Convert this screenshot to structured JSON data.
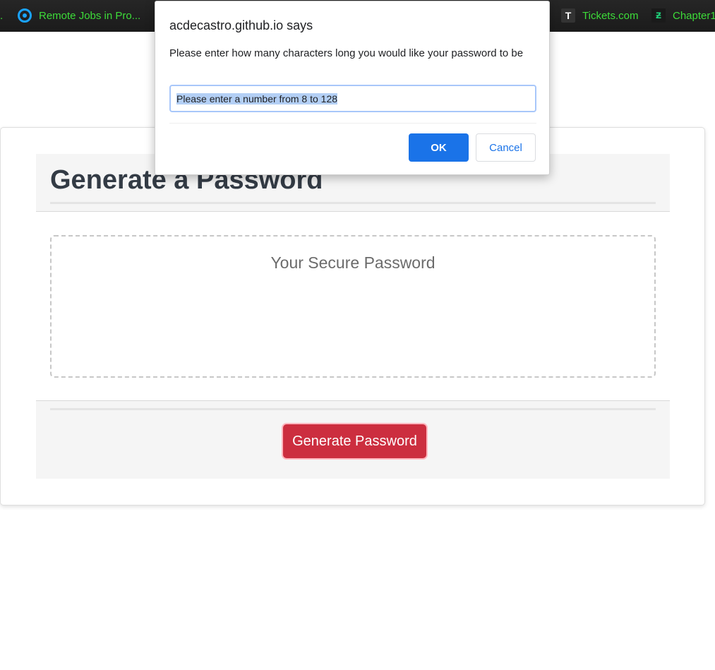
{
  "bookmarks": {
    "items": [
      {
        "label": ".",
        "icon": ""
      },
      {
        "label": "Remote Jobs in Pro...",
        "icon": "remote-jobs-icon"
      },
      {
        "label": "Tickets.com",
        "icon": "tickets-icon",
        "icon_glyph": "T"
      },
      {
        "label": "Chapter1",
        "icon": "chapter-icon",
        "icon_glyph": "ƶ"
      }
    ],
    "text_color": "#3ddc39"
  },
  "card": {
    "title": "Generate a Password",
    "password_placeholder": "Your Secure Password",
    "generate_label": "Generate Password",
    "generate_color": "#cc2e3f"
  },
  "dialog": {
    "title": "acdecastro.github.io says",
    "message": "Please enter how many characters long you would like your password to be",
    "input_value": "Please enter a number from 8 to 128",
    "ok_label": "OK",
    "cancel_label": "Cancel",
    "accent": "#1a73e8"
  }
}
